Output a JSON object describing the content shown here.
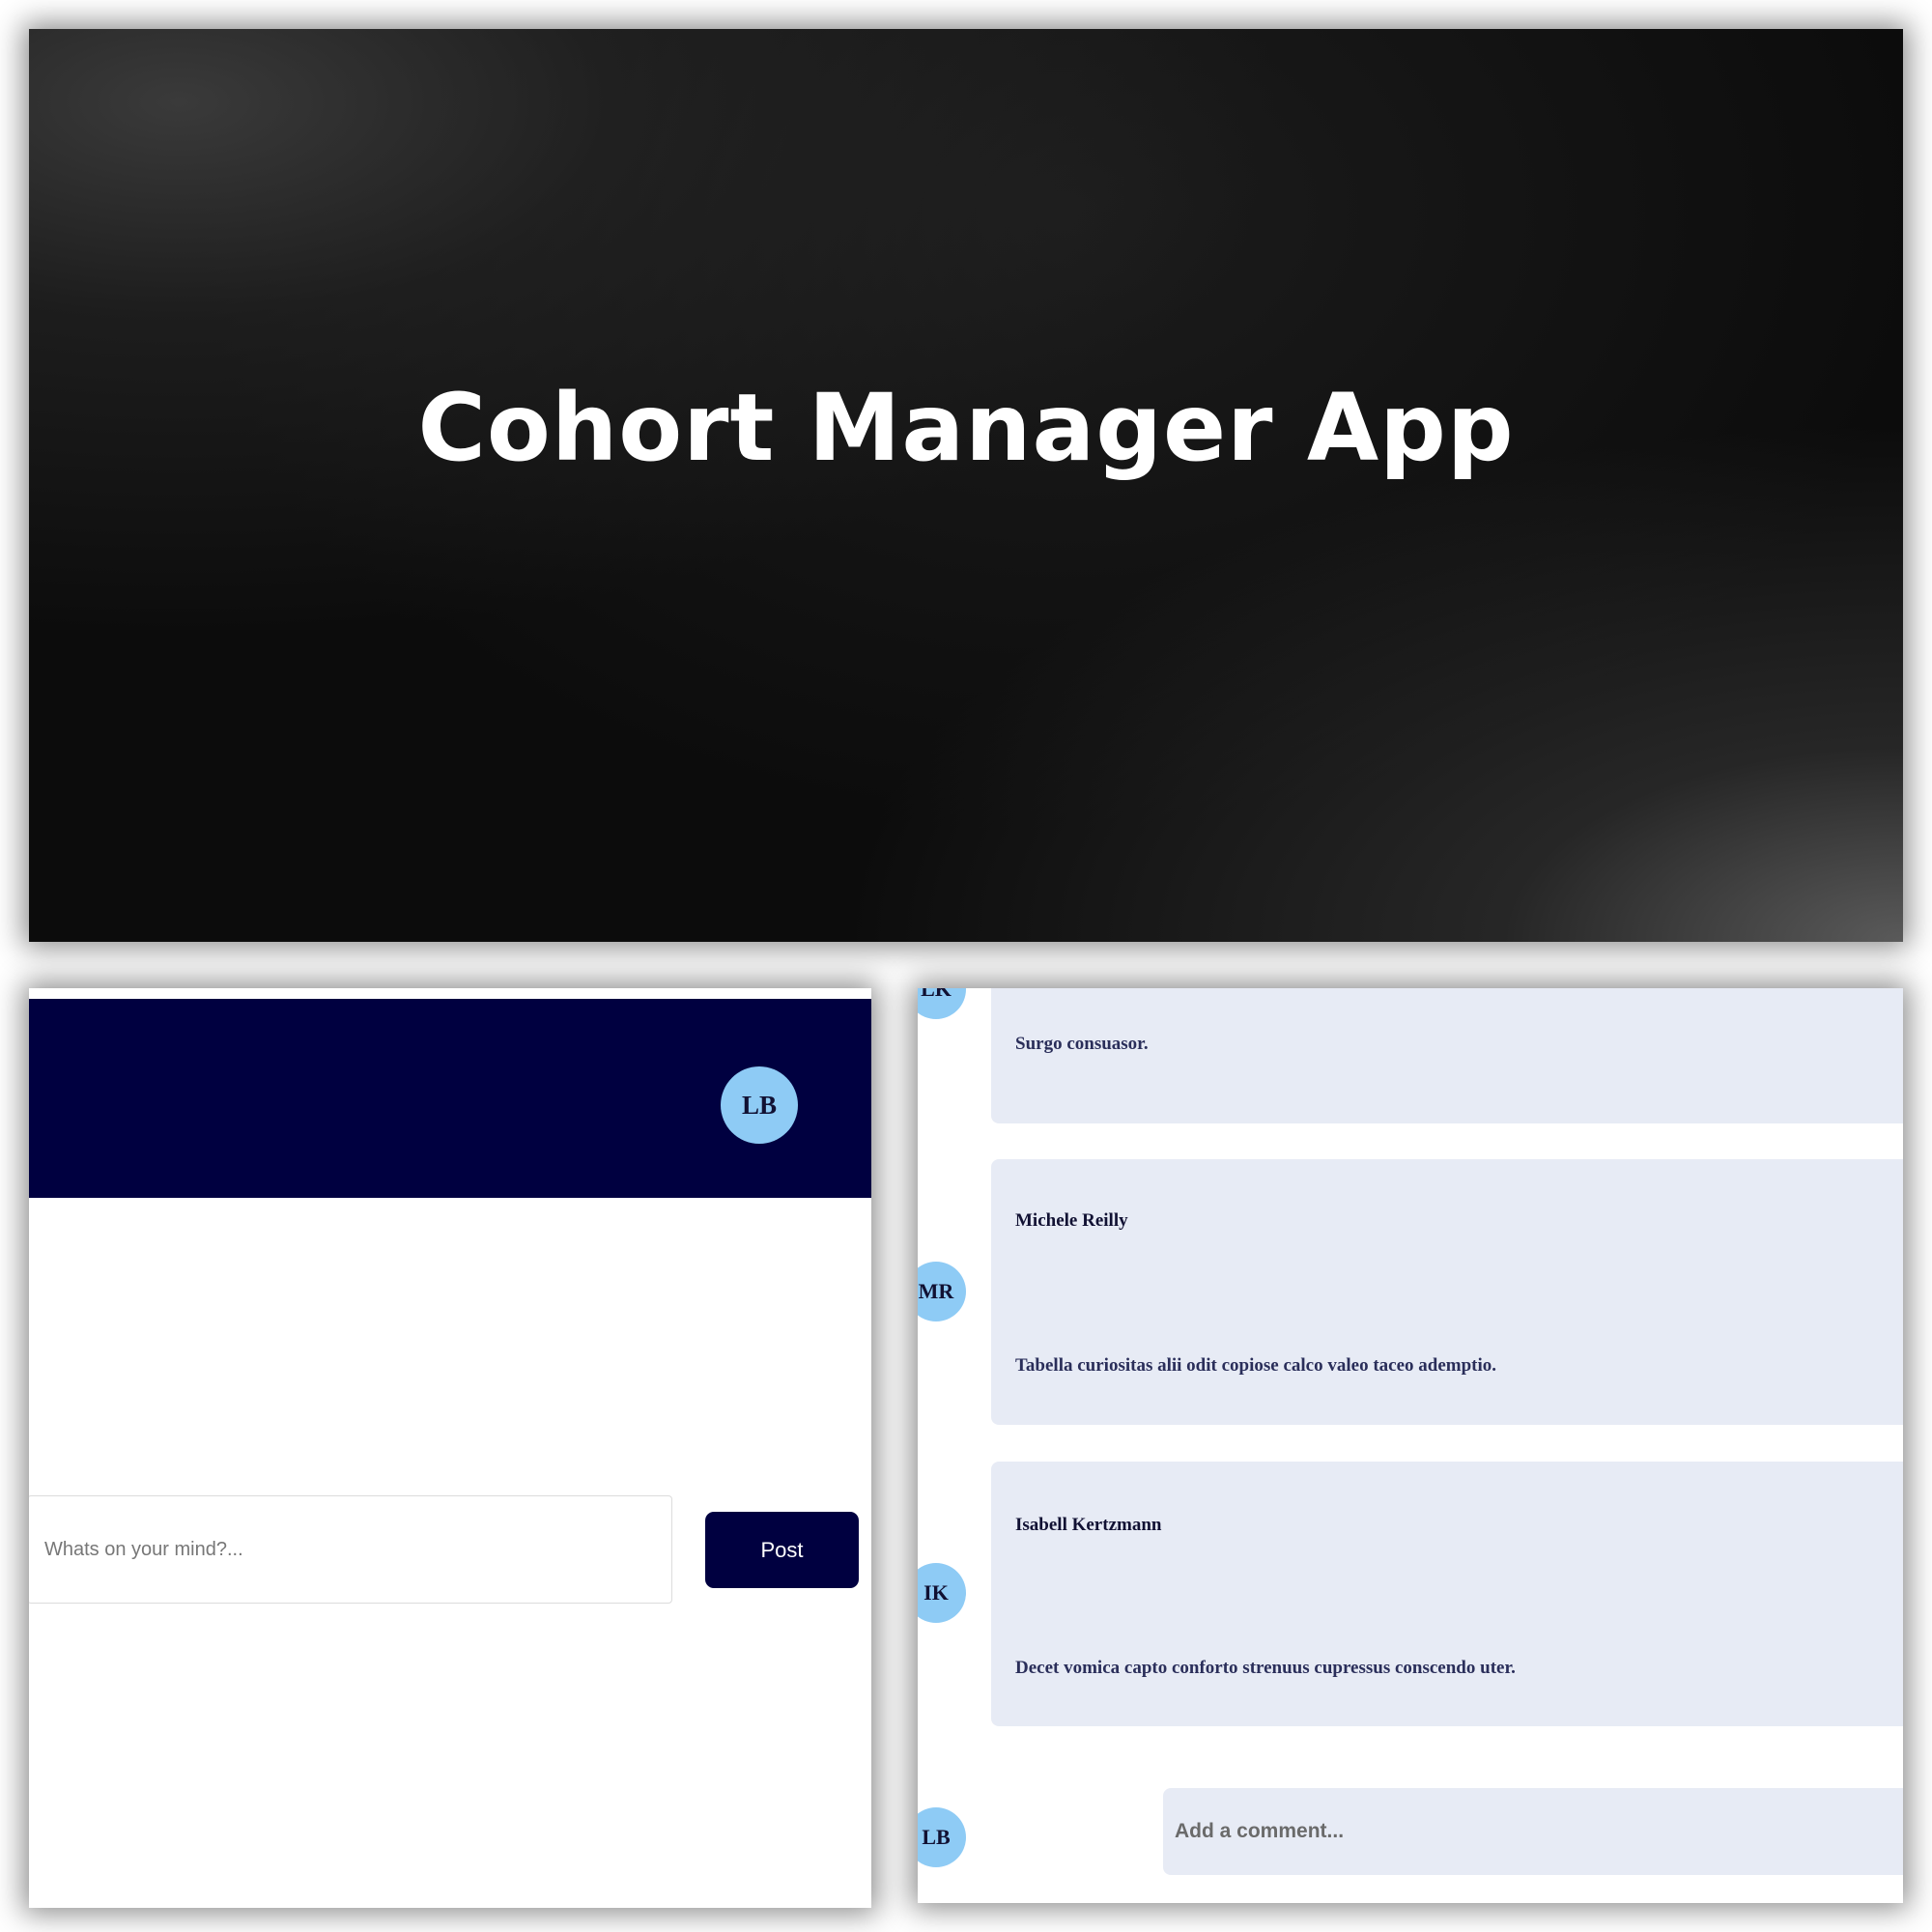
{
  "hero": {
    "title": "Cohort Manager App"
  },
  "feed": {
    "header_avatar": "LB",
    "post_placeholder": "Whats on your mind?...",
    "post_button": "Post"
  },
  "comments": {
    "items": [
      {
        "initials": "LK",
        "author": "",
        "text": "Surgo consuasor."
      },
      {
        "initials": "MR",
        "author": "Michele Reilly",
        "text": "Tabella curiositas alii odit copiose calco valeo taceo ademptio."
      },
      {
        "initials": "IK",
        "author": "Isabell Kertzmann",
        "text": "Decet vomica capto conforto strenuus cupressus conscendo uter."
      }
    ],
    "current_user_initials": "LB",
    "comment_placeholder": "Add a comment..."
  },
  "colors": {
    "header_navy": "#000040",
    "avatar_blue": "#8ecbf5",
    "card_bg": "#e7ebf5"
  }
}
